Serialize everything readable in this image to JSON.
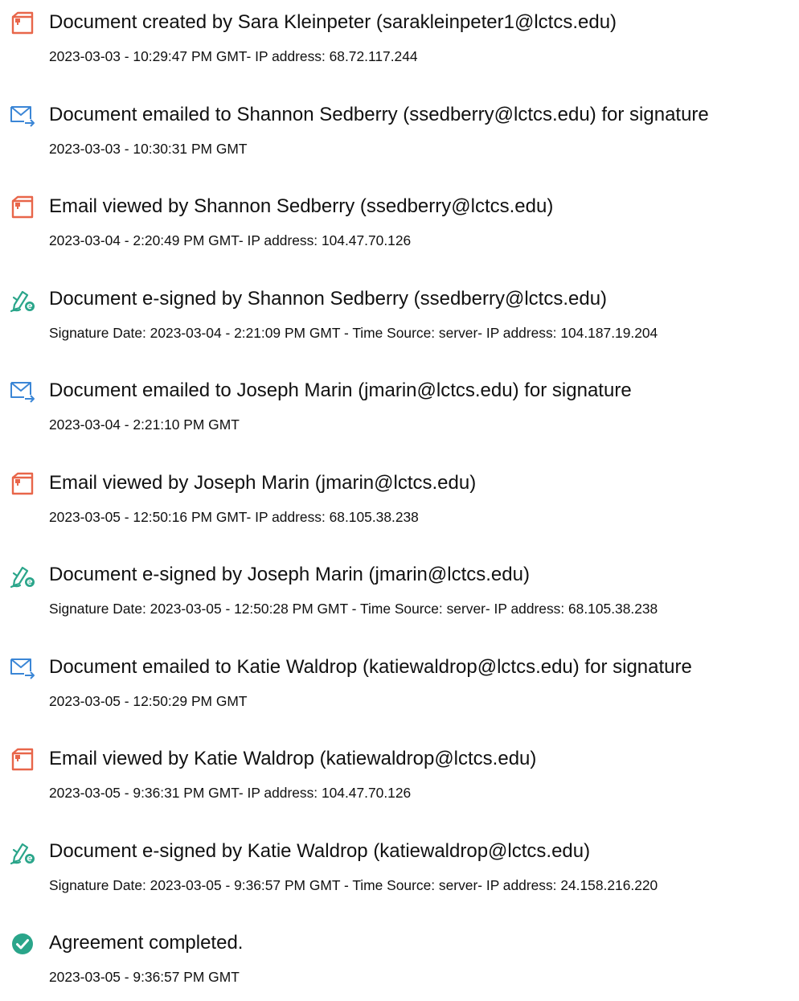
{
  "colors": {
    "viewed_icon": "#e8664a",
    "emailed_icon": "#3b86d6",
    "signed_icon": "#2aa58a",
    "completed_icon": "#2aa58a",
    "text": "#111111"
  },
  "events": [
    {
      "icon": "document-created-icon",
      "title": "Document created by Sara Kleinpeter (sarakleinpeter1@lctcs.edu)",
      "detail": "2023-03-03 - 10:29:47 PM GMT- IP address: 68.72.117.244"
    },
    {
      "icon": "email-sent-icon",
      "title": "Document emailed to Shannon Sedberry (ssedberry@lctcs.edu) for signature",
      "detail": "2023-03-03 - 10:30:31 PM GMT"
    },
    {
      "icon": "email-viewed-icon",
      "title": "Email viewed by Shannon Sedberry (ssedberry@lctcs.edu)",
      "detail": "2023-03-04 - 2:20:49 PM GMT- IP address: 104.47.70.126"
    },
    {
      "icon": "e-sign-pen-icon",
      "title": "Document e-signed by Shannon Sedberry (ssedberry@lctcs.edu)",
      "detail": "Signature Date: 2023-03-04 - 2:21:09 PM GMT - Time Source: server- IP address: 104.187.19.204"
    },
    {
      "icon": "email-sent-icon",
      "title": "Document emailed to Joseph Marin (jmarin@lctcs.edu) for signature",
      "detail": "2023-03-04 - 2:21:10 PM GMT"
    },
    {
      "icon": "email-viewed-icon",
      "title": "Email viewed by Joseph Marin (jmarin@lctcs.edu)",
      "detail": "2023-03-05 - 12:50:16 PM GMT- IP address: 68.105.38.238"
    },
    {
      "icon": "e-sign-pen-icon",
      "title": "Document e-signed by Joseph Marin (jmarin@lctcs.edu)",
      "detail": "Signature Date: 2023-03-05 - 12:50:28 PM GMT - Time Source: server- IP address: 68.105.38.238"
    },
    {
      "icon": "email-sent-icon",
      "title": "Document emailed to Katie Waldrop (katiewaldrop@lctcs.edu) for signature",
      "detail": "2023-03-05 - 12:50:29 PM GMT"
    },
    {
      "icon": "email-viewed-icon",
      "title": "Email viewed by Katie Waldrop (katiewaldrop@lctcs.edu)",
      "detail": "2023-03-05 - 9:36:31 PM GMT- IP address: 104.47.70.126"
    },
    {
      "icon": "e-sign-pen-icon",
      "title": "Document e-signed by Katie Waldrop (katiewaldrop@lctcs.edu)",
      "detail": "Signature Date: 2023-03-05 - 9:36:57 PM GMT - Time Source: server- IP address: 24.158.216.220"
    },
    {
      "icon": "agreement-completed-check-icon",
      "title": "Agreement completed.",
      "detail": "2023-03-05 - 9:36:57 PM GMT"
    }
  ]
}
